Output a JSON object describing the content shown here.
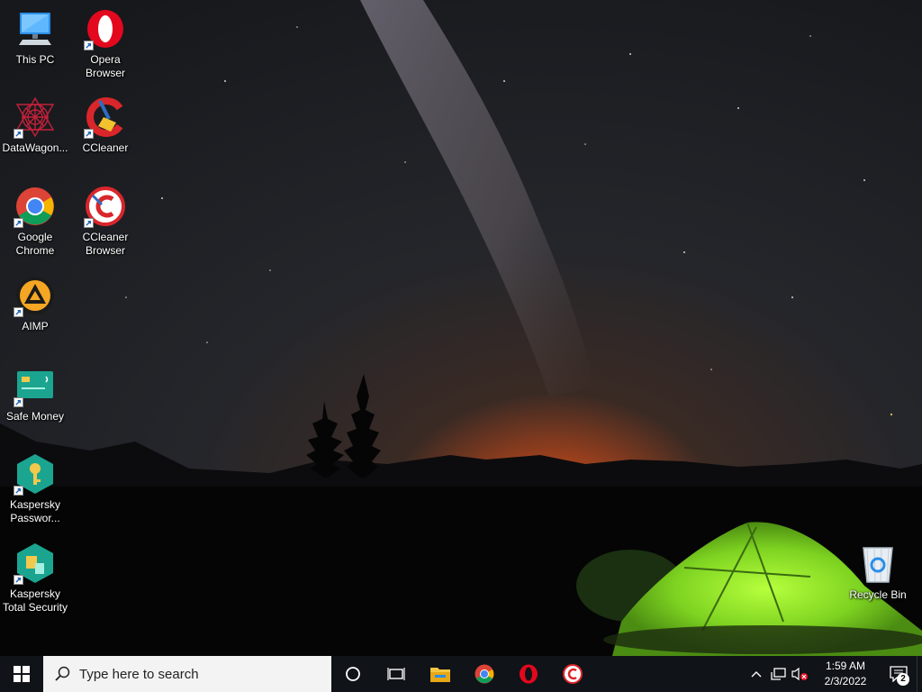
{
  "desktop": {
    "icons": [
      {
        "label": "This PC",
        "icon": "computer-icon"
      },
      {
        "label": "Opera\nBrowser",
        "icon": "opera-icon"
      },
      {
        "label": "DataWagon...",
        "icon": "datawagon-icon"
      },
      {
        "label": "CCleaner",
        "icon": "ccleaner-icon"
      },
      {
        "label": "Google\nChrome",
        "icon": "chrome-icon"
      },
      {
        "label": "CCleaner\nBrowser",
        "icon": "ccleaner-browser-icon"
      },
      {
        "label": "AIMP",
        "icon": "aimp-icon"
      },
      {
        "label": "Safe Money",
        "icon": "safe-money-icon"
      },
      {
        "label": "Kaspersky\nPasswor...",
        "icon": "kaspersky-password-icon"
      },
      {
        "label": "Kaspersky\nTotal Security",
        "icon": "kaspersky-total-security-icon"
      },
      {
        "label": "Recycle Bin",
        "icon": "recycle-bin-icon"
      }
    ]
  },
  "taskbar": {
    "start_icon": "windows-logo-icon",
    "search_placeholder": "Type here to search",
    "pinned_apps": [
      "file-explorer-icon",
      "chrome-icon",
      "opera-icon",
      "ccleaner-browser-icon"
    ],
    "clock": {
      "time": "1:59 AM",
      "date": "2/3/2022"
    },
    "notification_count": "2"
  },
  "colors": {
    "taskbar_bg": "#101318",
    "search_bg": "#f3f3f3",
    "tent_green": "#7ed321",
    "horizon_glow": "#e8651a"
  }
}
